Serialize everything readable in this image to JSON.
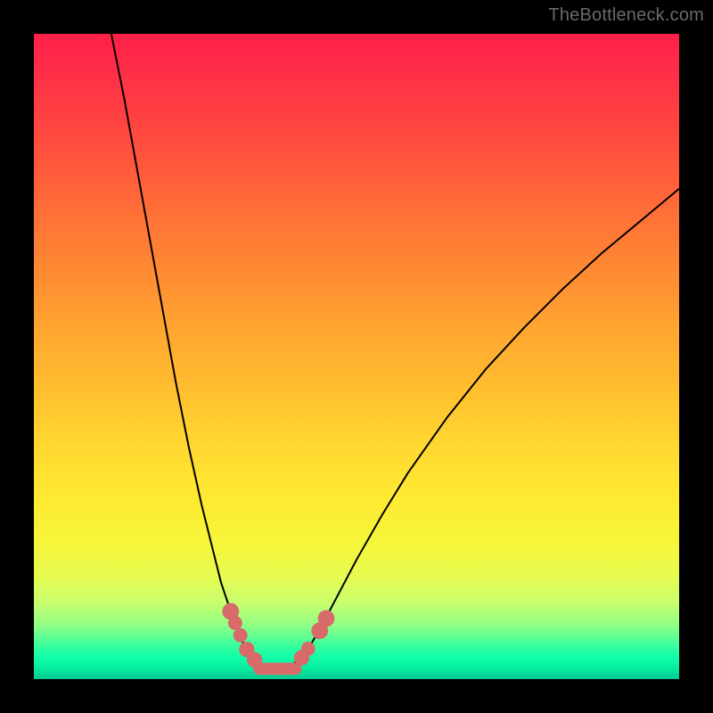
{
  "watermark": "TheBottleneck.com",
  "chart_data": {
    "type": "line",
    "title": "",
    "xlabel": "",
    "ylabel": "",
    "xlim": [
      0,
      100
    ],
    "ylim": [
      0,
      100
    ],
    "series": [
      {
        "name": "curve",
        "points": [
          {
            "x": 12,
            "y": 100
          },
          {
            "x": 14,
            "y": 90
          },
          {
            "x": 16,
            "y": 79
          },
          {
            "x": 18,
            "y": 68
          },
          {
            "x": 20,
            "y": 57
          },
          {
            "x": 22,
            "y": 46
          },
          {
            "x": 24,
            "y": 36
          },
          {
            "x": 26,
            "y": 27
          },
          {
            "x": 28,
            "y": 19
          },
          {
            "x": 29,
            "y": 15
          },
          {
            "x": 30,
            "y": 12
          },
          {
            "x": 31,
            "y": 9
          },
          {
            "x": 32,
            "y": 6.5
          },
          {
            "x": 33,
            "y": 4.4
          },
          {
            "x": 34,
            "y": 3.0
          },
          {
            "x": 35,
            "y": 2.1
          },
          {
            "x": 36,
            "y": 1.6
          },
          {
            "x": 37,
            "y": 1.4
          },
          {
            "x": 38,
            "y": 1.4
          },
          {
            "x": 39,
            "y": 1.6
          },
          {
            "x": 40,
            "y": 2.2
          },
          {
            "x": 41,
            "y": 3.0
          },
          {
            "x": 42,
            "y": 4.2
          },
          {
            "x": 43,
            "y": 5.5
          },
          {
            "x": 44,
            "y": 7.2
          },
          {
            "x": 45,
            "y": 9.0
          },
          {
            "x": 47,
            "y": 12.8
          },
          {
            "x": 50,
            "y": 18.5
          },
          {
            "x": 54,
            "y": 25.5
          },
          {
            "x": 58,
            "y": 32
          },
          {
            "x": 64,
            "y": 40.5
          },
          {
            "x": 70,
            "y": 48
          },
          {
            "x": 76,
            "y": 54.5
          },
          {
            "x": 82,
            "y": 60.5
          },
          {
            "x": 88,
            "y": 66
          },
          {
            "x": 94,
            "y": 71
          },
          {
            "x": 100,
            "y": 76
          }
        ]
      }
    ],
    "markers": [
      {
        "x": 30.5,
        "y": 10.5,
        "r": 1.3
      },
      {
        "x": 31.2,
        "y": 8.7,
        "r": 1.1
      },
      {
        "x": 32.0,
        "y": 6.8,
        "r": 1.1
      },
      {
        "x": 33.0,
        "y": 4.6,
        "r": 1.2
      },
      {
        "x": 34.2,
        "y": 3.0,
        "r": 1.2
      },
      {
        "x": 41.5,
        "y": 3.3,
        "r": 1.2
      },
      {
        "x": 42.5,
        "y": 4.7,
        "r": 1.1
      },
      {
        "x": 44.3,
        "y": 7.5,
        "r": 1.3
      },
      {
        "x": 45.3,
        "y": 9.4,
        "r": 1.3
      }
    ],
    "minimum_band": {
      "x_start": 34.0,
      "x_end": 41.5,
      "y": 1.6,
      "thickness": 1.9
    }
  }
}
